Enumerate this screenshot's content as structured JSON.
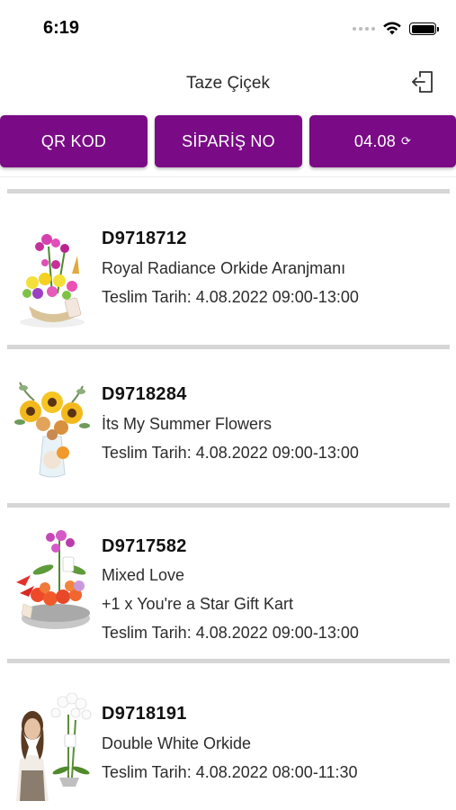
{
  "status_bar": {
    "time": "6:19"
  },
  "header": {
    "title": "Taze Çiçek",
    "logout_icon": "logout-icon"
  },
  "tabs": [
    {
      "label": "QR KOD"
    },
    {
      "label": "SİPARİŞ NO"
    },
    {
      "label": "04.08",
      "icon": "refresh-icon",
      "icon_glyph": "⟳"
    }
  ],
  "accent_color": "#7a0a86",
  "orders": [
    {
      "id": "D9718712",
      "lines": [
        "Royal Radiance Orkide Aranjmanı",
        "Teslim Tarih: 4.08.2022 09:00-13:00"
      ]
    },
    {
      "id": "D9718284",
      "lines": [
        "İts My Summer Flowers",
        "Teslim Tarih: 4.08.2022 09:00-13:00"
      ]
    },
    {
      "id": "D9717582",
      "lines": [
        "Mixed Love",
        "+1 x You're a Star Gift Kart",
        "Teslim Tarih: 4.08.2022 09:00-13:00"
      ]
    },
    {
      "id": "D9718191",
      "lines": [
        "Double White Orkide",
        "Teslim Tarih: 4.08.2022 08:00-11:30"
      ]
    }
  ]
}
